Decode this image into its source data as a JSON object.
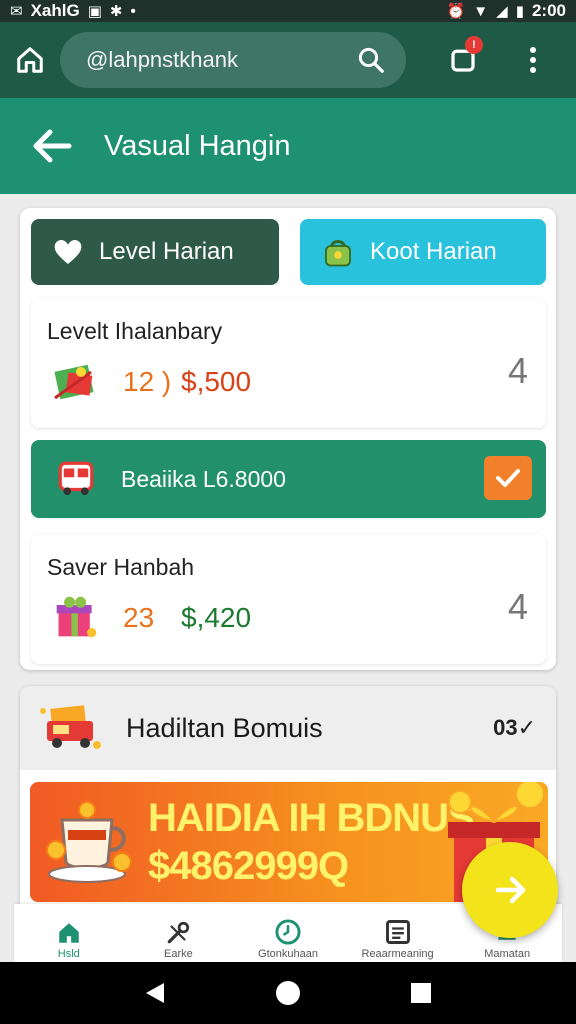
{
  "status_bar": {
    "carrier": "XahlG",
    "time": "2:00"
  },
  "browser": {
    "url": "@lahpnstkhank"
  },
  "header": {
    "title": "Vasual Hangin"
  },
  "tabs": [
    {
      "label": "Level Harian",
      "icon": "heart-icon",
      "active": true
    },
    {
      "label": "Koot Harian",
      "icon": "bag-icon",
      "active": false
    }
  ],
  "items": [
    {
      "title": "Levelt Ihalanbary",
      "count": "12 )",
      "amount": "$,500",
      "action": "4",
      "icon": "gift-box-icon"
    },
    {
      "label": "Beaiika L6.8000",
      "checked": true,
      "icon": "bus-icon"
    },
    {
      "title": "Saver Hanbah",
      "count": "23",
      "amount": "$,420",
      "action": "4",
      "icon": "present-icon"
    }
  ],
  "bonus": {
    "title": "Hadiltan Bomuis",
    "check_text": "03✓",
    "icon": "truck-icon"
  },
  "promo": {
    "title": "HAIDIA IH BDNUS",
    "amount": "$4862999Q",
    "icon": "gift-icon"
  },
  "bottom_nav": [
    {
      "label": "Hsld",
      "icon": "home-icon",
      "active": true
    },
    {
      "label": "Earke",
      "icon": "tools-icon",
      "active": false
    },
    {
      "label": "Gtonkuhaan",
      "icon": "clock-icon",
      "active": false
    },
    {
      "label": "Reaarmeaning",
      "icon": "list-icon",
      "active": false
    },
    {
      "label": "Mamatan",
      "icon": "menu-icon",
      "active": false
    }
  ],
  "colors": {
    "primary": "#1e9170",
    "dark": "#1f5a47",
    "accent": "#f27f29",
    "cyan": "#29c2dc"
  }
}
